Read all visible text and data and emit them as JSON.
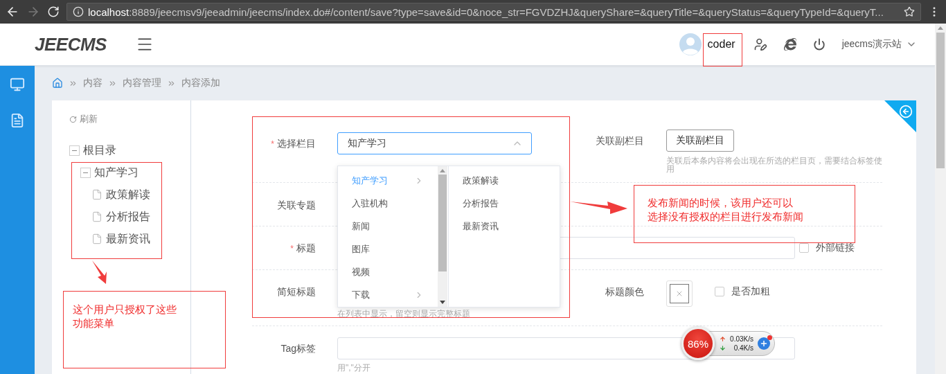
{
  "browser": {
    "url_host": "localhost",
    "url_path": ":8889/jeecmsv9/jeeadmin/jeecms/index.do#/content/save?type=save&id=0&noce_str=FGVDZHJ&queryShare=&queryTitle=&queryStatus=&queryTypeId=&queryT..."
  },
  "header": {
    "logo": "JEECMS",
    "username": "coder",
    "site": "jeecms演示站"
  },
  "breadcrumb": [
    "内容",
    "内容管理",
    "内容添加"
  ],
  "tree": {
    "refresh": "刷新",
    "items": [
      {
        "label": "根目录",
        "expanded": true,
        "children": [
          {
            "label": "知产学习",
            "expanded": true,
            "children": [
              {
                "label": "政策解读"
              },
              {
                "label": "分析报告"
              },
              {
                "label": "最新资讯"
              }
            ]
          }
        ]
      }
    ]
  },
  "form": {
    "column": {
      "mark": "*",
      "label": "选择栏目",
      "value": "知产学习",
      "open": true
    },
    "sub_column": {
      "label": "关联副栏目",
      "button": "关联副栏目",
      "hint": "关联后本条内容将会出现在所选的栏目页，需要结合标签使用"
    },
    "topic": {
      "label": "关联专题"
    },
    "title": {
      "mark": "*",
      "label": "标题",
      "checkbox": {
        "label": "外部链接",
        "checked": false
      }
    },
    "short_title": {
      "label": "简短标题",
      "hint": "在列表中显示，留空则显示完整标题"
    },
    "title_color": {
      "label": "标题颜色",
      "checkbox": {
        "label": "是否加粗",
        "checked": false
      }
    },
    "tag": {
      "label": "Tag标签",
      "hint": "用\",\"分开"
    }
  },
  "dropdown": {
    "columns": [
      {
        "items": [
          {
            "label": "知产学习",
            "selected": true,
            "has_children": true
          },
          {
            "label": "入驻机构",
            "selected": false
          },
          {
            "label": "新闻",
            "selected": false
          },
          {
            "label": "图库",
            "selected": false
          },
          {
            "label": "视频",
            "selected": false
          },
          {
            "label": "下载",
            "selected": false,
            "has_children": true
          }
        ]
      },
      {
        "items": [
          {
            "label": "政策解读",
            "selected": false
          },
          {
            "label": "分析报告",
            "selected": false
          },
          {
            "label": "最新资讯",
            "selected": false
          }
        ]
      }
    ]
  },
  "annotations": [
    {
      "lines": [
        "这个用户只授权了这些",
        "功能菜单"
      ]
    },
    {
      "lines": [
        "发布新闻的时候，该用户还可以",
        "选择没有授权的栏目进行发布新闻"
      ]
    }
  ],
  "speed_widget": {
    "percent": "86%",
    "up": "0.03K/s",
    "down": "0.4K/s"
  }
}
